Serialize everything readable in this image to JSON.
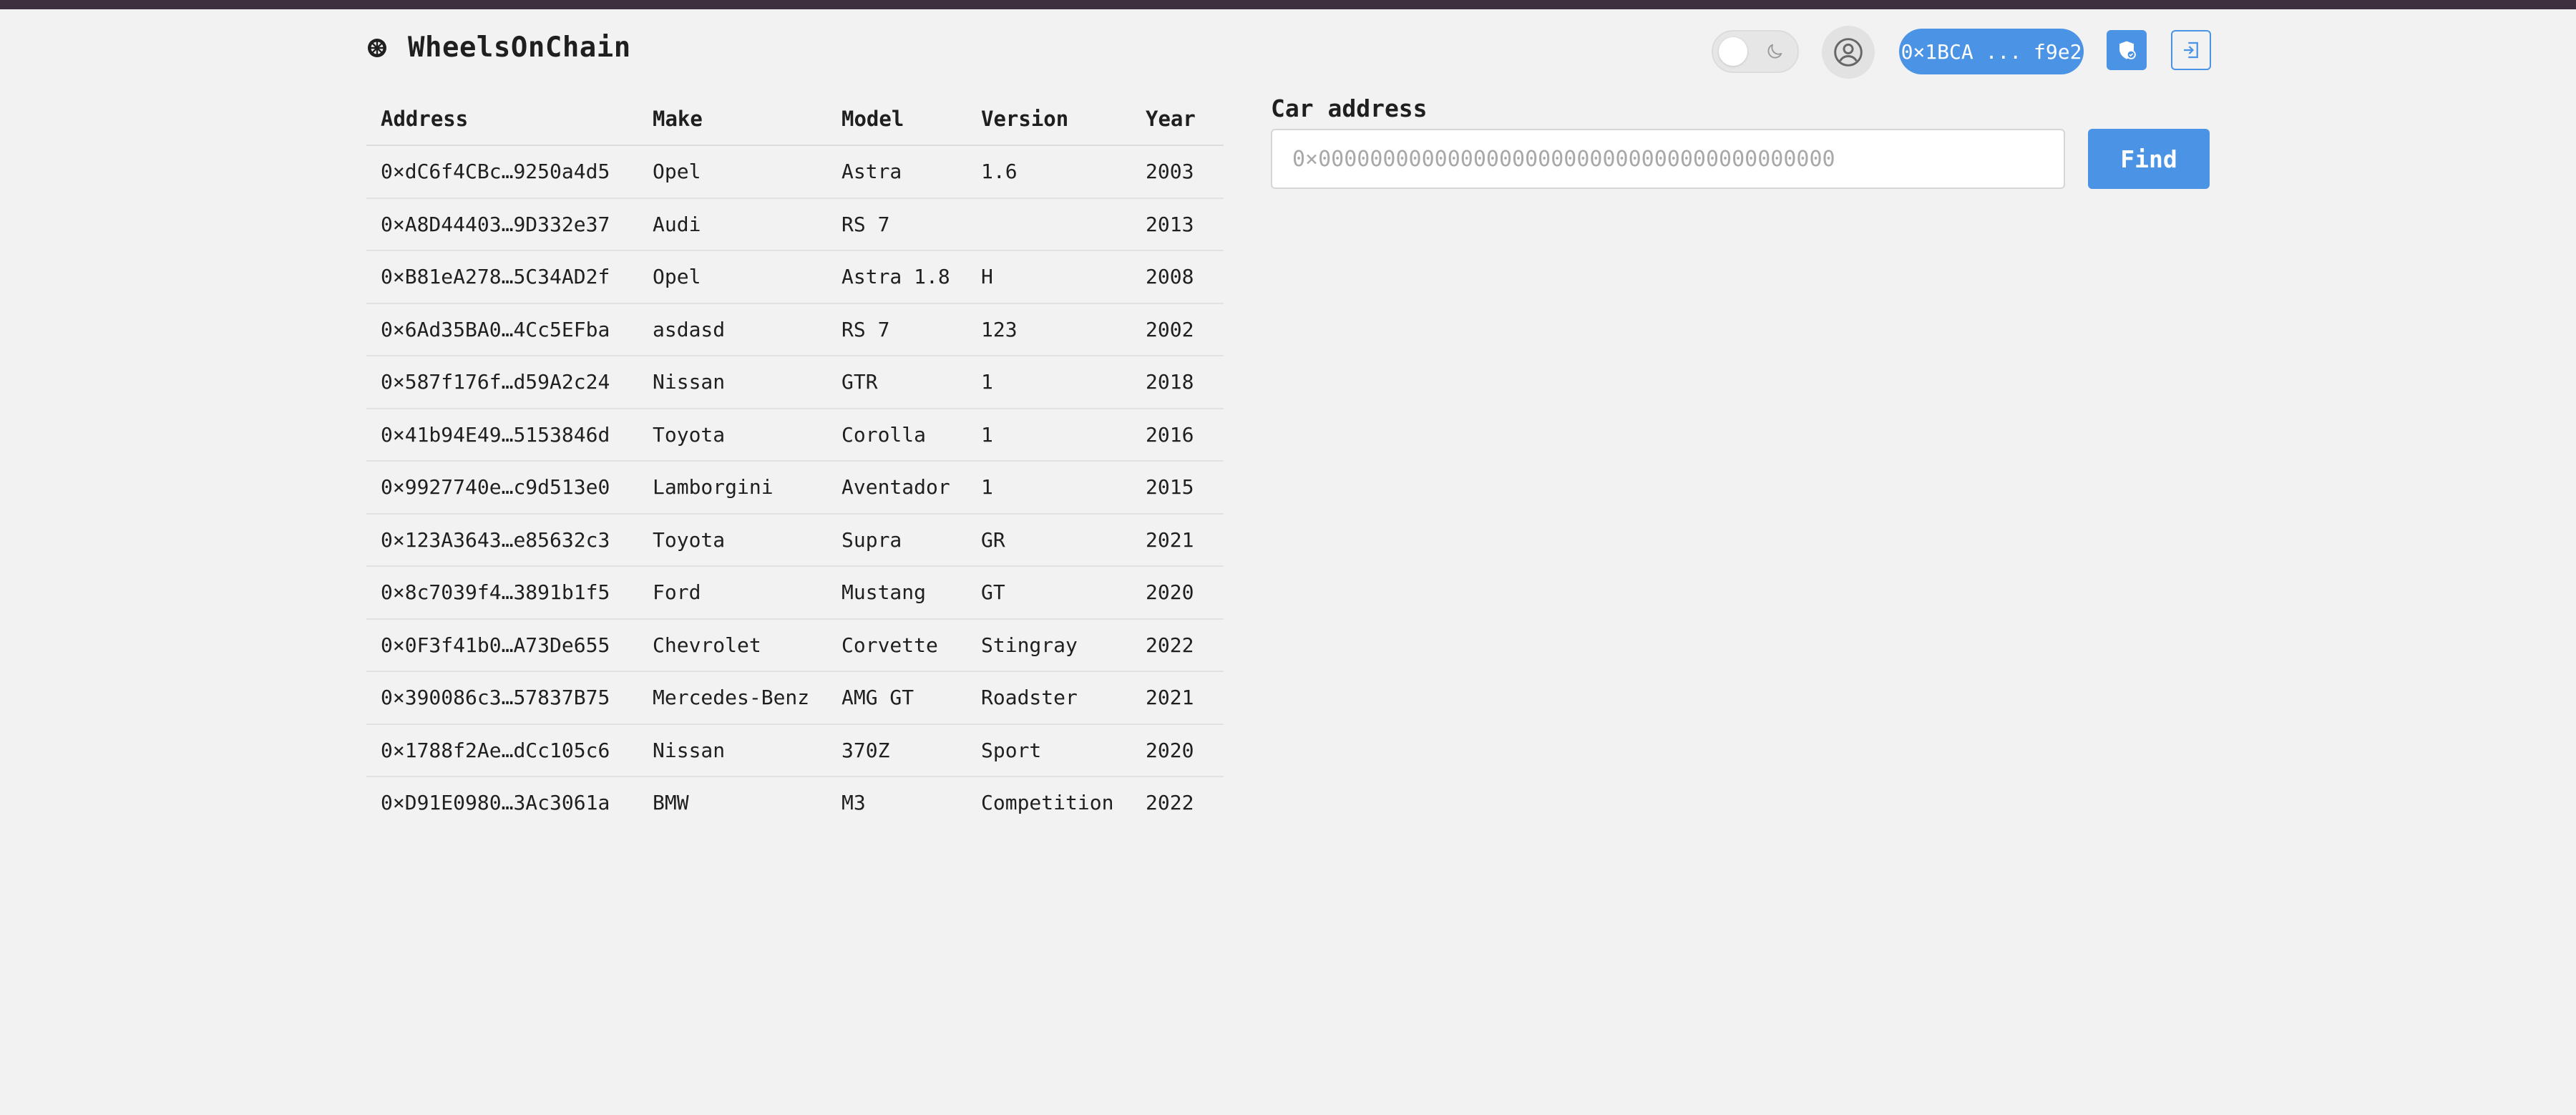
{
  "app": {
    "title": "WheelsOnChain"
  },
  "header": {
    "wallet_label": "0×1BCA ... f9e2",
    "accent_color": "#4a93e5"
  },
  "table": {
    "headers": [
      "Address",
      "Make",
      "Model",
      "Version",
      "Year"
    ],
    "rows": [
      {
        "address": "0×dC6f4CBc",
        "address_end": "9250a4d5",
        "make": "Opel",
        "model": "Astra",
        "version": "1.6",
        "year": "2003"
      },
      {
        "address": "0×A8D44403",
        "address_end": "9D332e37",
        "make": "Audi",
        "model": "RS 7",
        "version": "",
        "year": "2013"
      },
      {
        "address": "0×B81eA278",
        "address_end": "5C34AD2f",
        "make": "Opel",
        "model": "Astra 1.8",
        "version": "H",
        "year": "2008"
      },
      {
        "address": "0×6Ad35BA0",
        "address_end": "4Cc5EFba",
        "make": "asdasd",
        "model": "RS 7",
        "version": "123",
        "year": "2002"
      },
      {
        "address": "0×587f176f",
        "address_end": "d59A2c24",
        "make": "Nissan",
        "model": "GTR",
        "version": "1",
        "year": "2018"
      },
      {
        "address": "0×41b94E49",
        "address_end": "5153846d",
        "make": "Toyota",
        "model": "Corolla",
        "version": "1",
        "year": "2016"
      },
      {
        "address": "0×9927740e",
        "address_end": "c9d513e0",
        "make": "Lamborgini",
        "model": "Aventador",
        "version": "1",
        "year": "2015"
      },
      {
        "address": "0×123A3643",
        "address_end": "e85632c3",
        "make": "Toyota",
        "model": "Supra",
        "version": "GR",
        "year": "2021"
      },
      {
        "address": "0×8c7039f4",
        "address_end": "3891b1f5",
        "make": "Ford",
        "model": "Mustang",
        "version": "GT",
        "year": "2020"
      },
      {
        "address": "0×0F3f41b0",
        "address_end": "A73De655",
        "make": "Chevrolet",
        "model": "Corvette",
        "version": "Stingray",
        "year": "2022"
      },
      {
        "address": "0×390086c3",
        "address_end": "57837B75",
        "make": "Mercedes-Benz",
        "model": "AMG GT",
        "version": "Roadster",
        "year": "2021"
      },
      {
        "address": "0×1788f2Ae",
        "address_end": "dCc105c6",
        "make": "Nissan",
        "model": "370Z",
        "version": "Sport",
        "year": "2020"
      },
      {
        "address": "0×D91E0980",
        "address_end": "3Ac3061a",
        "make": "BMW",
        "model": "M3",
        "version": "Competition",
        "year": "2022"
      }
    ]
  },
  "search": {
    "label": "Car address",
    "placeholder": "0×0000000000000000000000000000000000000000",
    "value": "",
    "button_label": "Find"
  },
  "icons": {
    "logo": "wheel-icon",
    "theme": "moon-icon",
    "profile": "user-circle-icon",
    "shield": "shield-icon",
    "logout": "exit-icon"
  }
}
